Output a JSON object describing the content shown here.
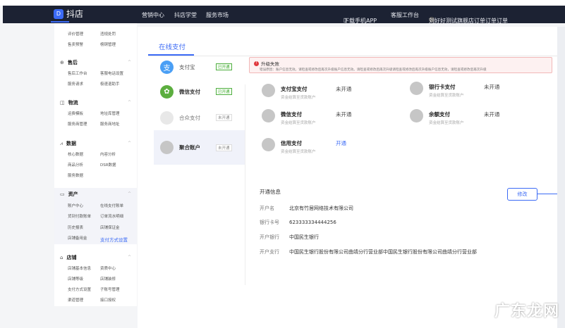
{
  "nav": {
    "logo": "抖店",
    "links": [
      "营销中心",
      "抖店学堂",
      "服务市场"
    ],
    "download": "下载手机APP",
    "service": "客服工作台",
    "shop": "刘好好测试旗舰店订单订单订单"
  },
  "sidebar": {
    "top_items": [
      "评价管理",
      "违规处罚",
      "售卖预警",
      "榜铜管理"
    ],
    "sections": [
      {
        "title": "售后",
        "items": [
          "售后工作台",
          "客服电话设置",
          "服务请求",
          "极速退助手"
        ]
      },
      {
        "title": "物流",
        "items": [
          "运费模板",
          "地址库管理",
          "服务商管理",
          "服务商地址"
        ]
      },
      {
        "title": "数据",
        "items": [
          "核心数据",
          "内容分析",
          "商品分析",
          "DSR数据",
          "服务数据"
        ]
      },
      {
        "title": "资产",
        "items": [
          "账户中心",
          "在线支付账单",
          "货到付款账单",
          "订单流水明细",
          "历史报表",
          "店铺保证金",
          "店铺备用金",
          "支付方式设置"
        ]
      },
      {
        "title": "店铺",
        "items": [
          "店铺基本信息",
          "资质中心",
          "店铺等级",
          "店铺装修",
          "支付方式设置",
          "子账号管理",
          "渠道管理",
          "接口授权"
        ]
      }
    ]
  },
  "main": {
    "tab": "在线支付",
    "providers": [
      {
        "name": "支付宝",
        "badge": "已开通"
      },
      {
        "name": "微信支付",
        "badge": "已开通"
      },
      {
        "name": "合众支付",
        "badge": "未开通"
      },
      {
        "name": "聚合账户",
        "badge": "未开通"
      }
    ],
    "error": {
      "title": "升级失败",
      "detail": "错误原因：账户信息无效。请检查或修改后再次升级账户信息无效。请检查或修改后再次升级请检查或修改后再次升级账户信息无效，请检查或修改后再次升级"
    },
    "options": [
      {
        "name": "支付宝支付",
        "desc": "资金结算至货款账户",
        "status": "未开通"
      },
      {
        "name": "银行卡支付",
        "desc": "资金结算至货款账户",
        "status": "未开通"
      },
      {
        "name": "微信支付",
        "desc": "资金结算至货款账户",
        "status": "未开通"
      },
      {
        "name": "余额支付",
        "desc": "资金结算至货款账户",
        "status": "未开通"
      },
      {
        "name": "信用支付",
        "desc": "资金结算至货款账户",
        "status": "开通"
      }
    ],
    "info": {
      "title": "开通信息",
      "edit": "修改",
      "rows": [
        {
          "label": "开户名",
          "value": "北京有竹居网络技术有限公司"
        },
        {
          "label": "银行卡号",
          "value": "623333334444256"
        },
        {
          "label": "开户银行",
          "value": "中国民生银行"
        },
        {
          "label": "开户支行",
          "value": "中国民生银行股份有限公司曲靖分行营业部中国民生银行股份有限公司曲靖分行营业部"
        }
      ]
    }
  },
  "watermark": "广东龙网",
  "colors": {
    "accent": "#3b6af5",
    "nav": "#1c2233",
    "success": "#52b043",
    "error": "#e0393e"
  }
}
